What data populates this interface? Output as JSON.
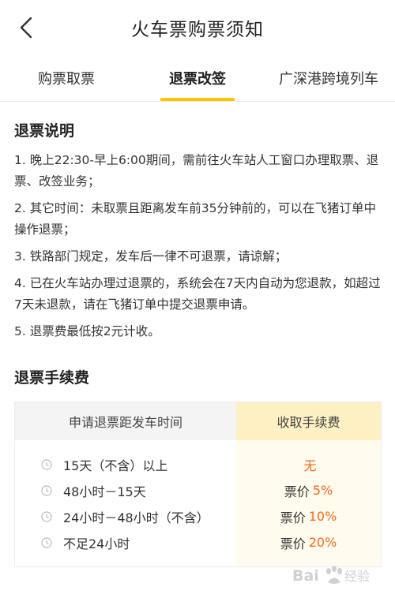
{
  "header": {
    "title": "火车票购票须知",
    "back_icon": "chevron-left-icon"
  },
  "tabs": [
    {
      "label": "购票取票",
      "active": false
    },
    {
      "label": "退票改签",
      "active": true
    },
    {
      "label": "广深港跨境列车",
      "active": false
    }
  ],
  "refund_notes": {
    "title": "退票说明",
    "items": [
      "1. 晚上22:30-早上6:00期间，需前往火车站人工窗口办理取票、退票、改签业务；",
      "2. 其它时间：未取票且距离发车前35分钟前的，可以在飞猪订单中操作退票；",
      "3. 铁路部门规定，发车后一律不可退票，请谅解；",
      "4. 已在火车站办理过退票的，系统会在7天内自动为您退款，如超过7天未退款，请在飞猪订单中提交退票申请。",
      "5. 退票费最低按2元计收。"
    ]
  },
  "fee_table": {
    "title": "退票手续费",
    "header_time": "申请退票距发车时间",
    "header_fee": "收取手续费",
    "rows": [
      {
        "time": "15天（不含）以上",
        "fee_label": "",
        "fee_value": "无"
      },
      {
        "time": "48小时－15天",
        "fee_label": "票价",
        "fee_value": "5%"
      },
      {
        "time": "24小时－48小时（不含）",
        "fee_label": "票价",
        "fee_value": "10%"
      },
      {
        "time": "不足24小时",
        "fee_label": "票价",
        "fee_value": "20%"
      }
    ]
  },
  "colors": {
    "accent": "#ffc300",
    "fee_text": "#f26a1b",
    "fee_header_bg": "#fdf0c3",
    "fee_col_bg": "#fffbee"
  },
  "watermark": "Bai经验"
}
